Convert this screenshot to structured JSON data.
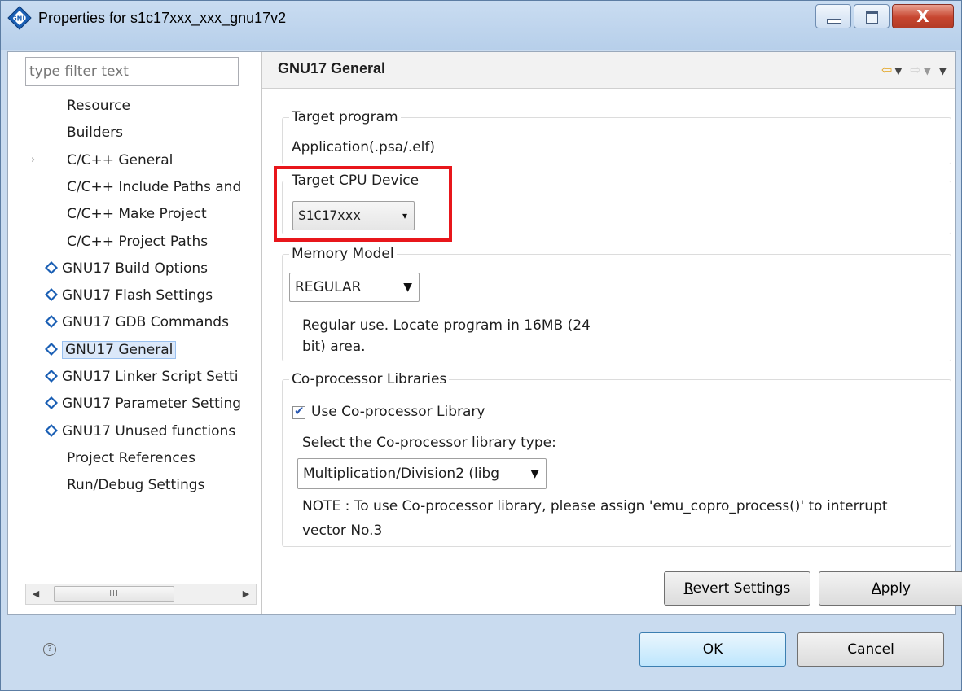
{
  "window": {
    "title": "Properties for s1c17xxx_xxx_gnu17v2",
    "close_glyph": "X"
  },
  "filter": {
    "placeholder": "type filter text"
  },
  "tree": {
    "items": [
      {
        "label": "Resource",
        "icon": "none"
      },
      {
        "label": "Builders",
        "icon": "none"
      },
      {
        "label": "C/C++ General",
        "icon": "none",
        "expandable": true
      },
      {
        "label": "C/C++ Include Paths and",
        "icon": "none"
      },
      {
        "label": "C/C++ Make Project",
        "icon": "none"
      },
      {
        "label": "C/C++ Project Paths",
        "icon": "none"
      },
      {
        "label": "GNU17 Build Options",
        "icon": "gnu-icon"
      },
      {
        "label": "GNU17 Flash Settings",
        "icon": "gnu-icon"
      },
      {
        "label": "GNU17 GDB Commands",
        "icon": "gnu-icon"
      },
      {
        "label": "GNU17 General",
        "icon": "gnu-icon",
        "selected": true
      },
      {
        "label": "GNU17 Linker Script Setti",
        "icon": "gnu-icon"
      },
      {
        "label": "GNU17 Parameter Setting",
        "icon": "gnu-icon"
      },
      {
        "label": "GNU17 Unused functions",
        "icon": "gnu-icon"
      },
      {
        "label": "Project References",
        "icon": "none"
      },
      {
        "label": "Run/Debug Settings",
        "icon": "none"
      }
    ],
    "scroll_thumb_grip": "III"
  },
  "page": {
    "title": "GNU17 General",
    "target_program": {
      "label": "Target program",
      "value": "Application(.psa/.elf)"
    },
    "target_cpu": {
      "label": "Target CPU Device",
      "selected": "S1C17xxx"
    },
    "memory_model": {
      "label": "Memory Model",
      "selected": "REGULAR",
      "description_line1": "Regular use. Locate program in 16MB (24",
      "description_line2": "bit) area."
    },
    "coprocessor": {
      "label": "Co-processor Libraries",
      "use_checkbox_label": "Use Co-processor Library",
      "use_checked": true,
      "type_label": "Select the Co-processor library type:",
      "type_selected": "Multiplication/Division2 (libg",
      "note_line1": "NOTE : To use Co-processor library, please assign 'emu_copro_process()' to interrupt",
      "note_line2": "vector No.3"
    },
    "revert_button": {
      "mnemonic": "R",
      "rest": "evert Settings"
    },
    "apply_button": {
      "mnemonic": "A",
      "rest": "pply"
    }
  },
  "footer": {
    "help_glyph": "?",
    "ok_label": "OK",
    "cancel_label": "Cancel"
  },
  "colors": {
    "highlight_border": "#e8161b",
    "selection_bg": "#dbe8f9",
    "titlebar": "#c9dcf1",
    "close_button": "#c74630"
  }
}
